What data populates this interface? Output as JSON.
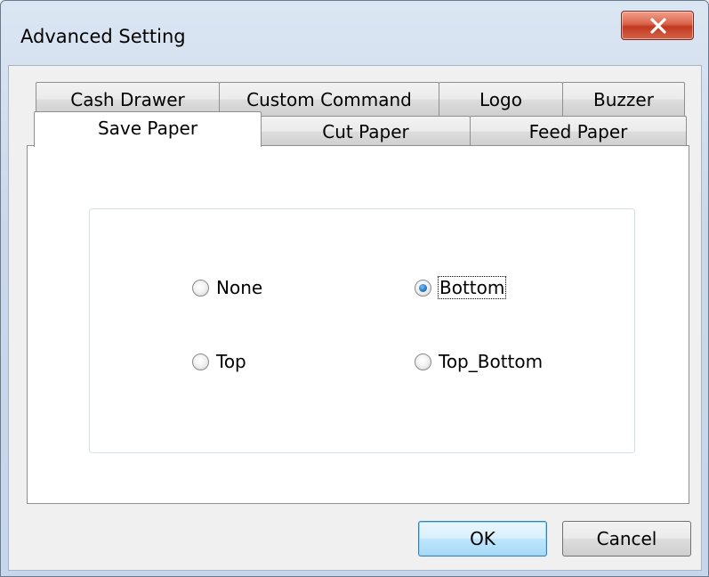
{
  "window": {
    "title": "Advanced Setting",
    "close_icon": "close-x-icon"
  },
  "tabs": {
    "row_back": [
      {
        "label": "Cash Drawer"
      },
      {
        "label": "Custom Command"
      },
      {
        "label": "Logo"
      },
      {
        "label": "Buzzer"
      }
    ],
    "row_front": [
      {
        "label": "Save Paper",
        "active": true
      },
      {
        "label": "Cut Paper",
        "active": false
      },
      {
        "label": "Feed Paper",
        "active": false
      }
    ]
  },
  "save_paper": {
    "options": [
      {
        "label": "None",
        "checked": false
      },
      {
        "label": "Bottom",
        "checked": true
      },
      {
        "label": "Top",
        "checked": false
      },
      {
        "label": "Top_Bottom",
        "checked": false
      }
    ]
  },
  "buttons": {
    "ok_label": "OK",
    "cancel_label": "Cancel"
  },
  "colors": {
    "close_button": "#c1391f",
    "radio_checked": "#2a7ad0",
    "default_button_border": "#3c7fb1"
  }
}
